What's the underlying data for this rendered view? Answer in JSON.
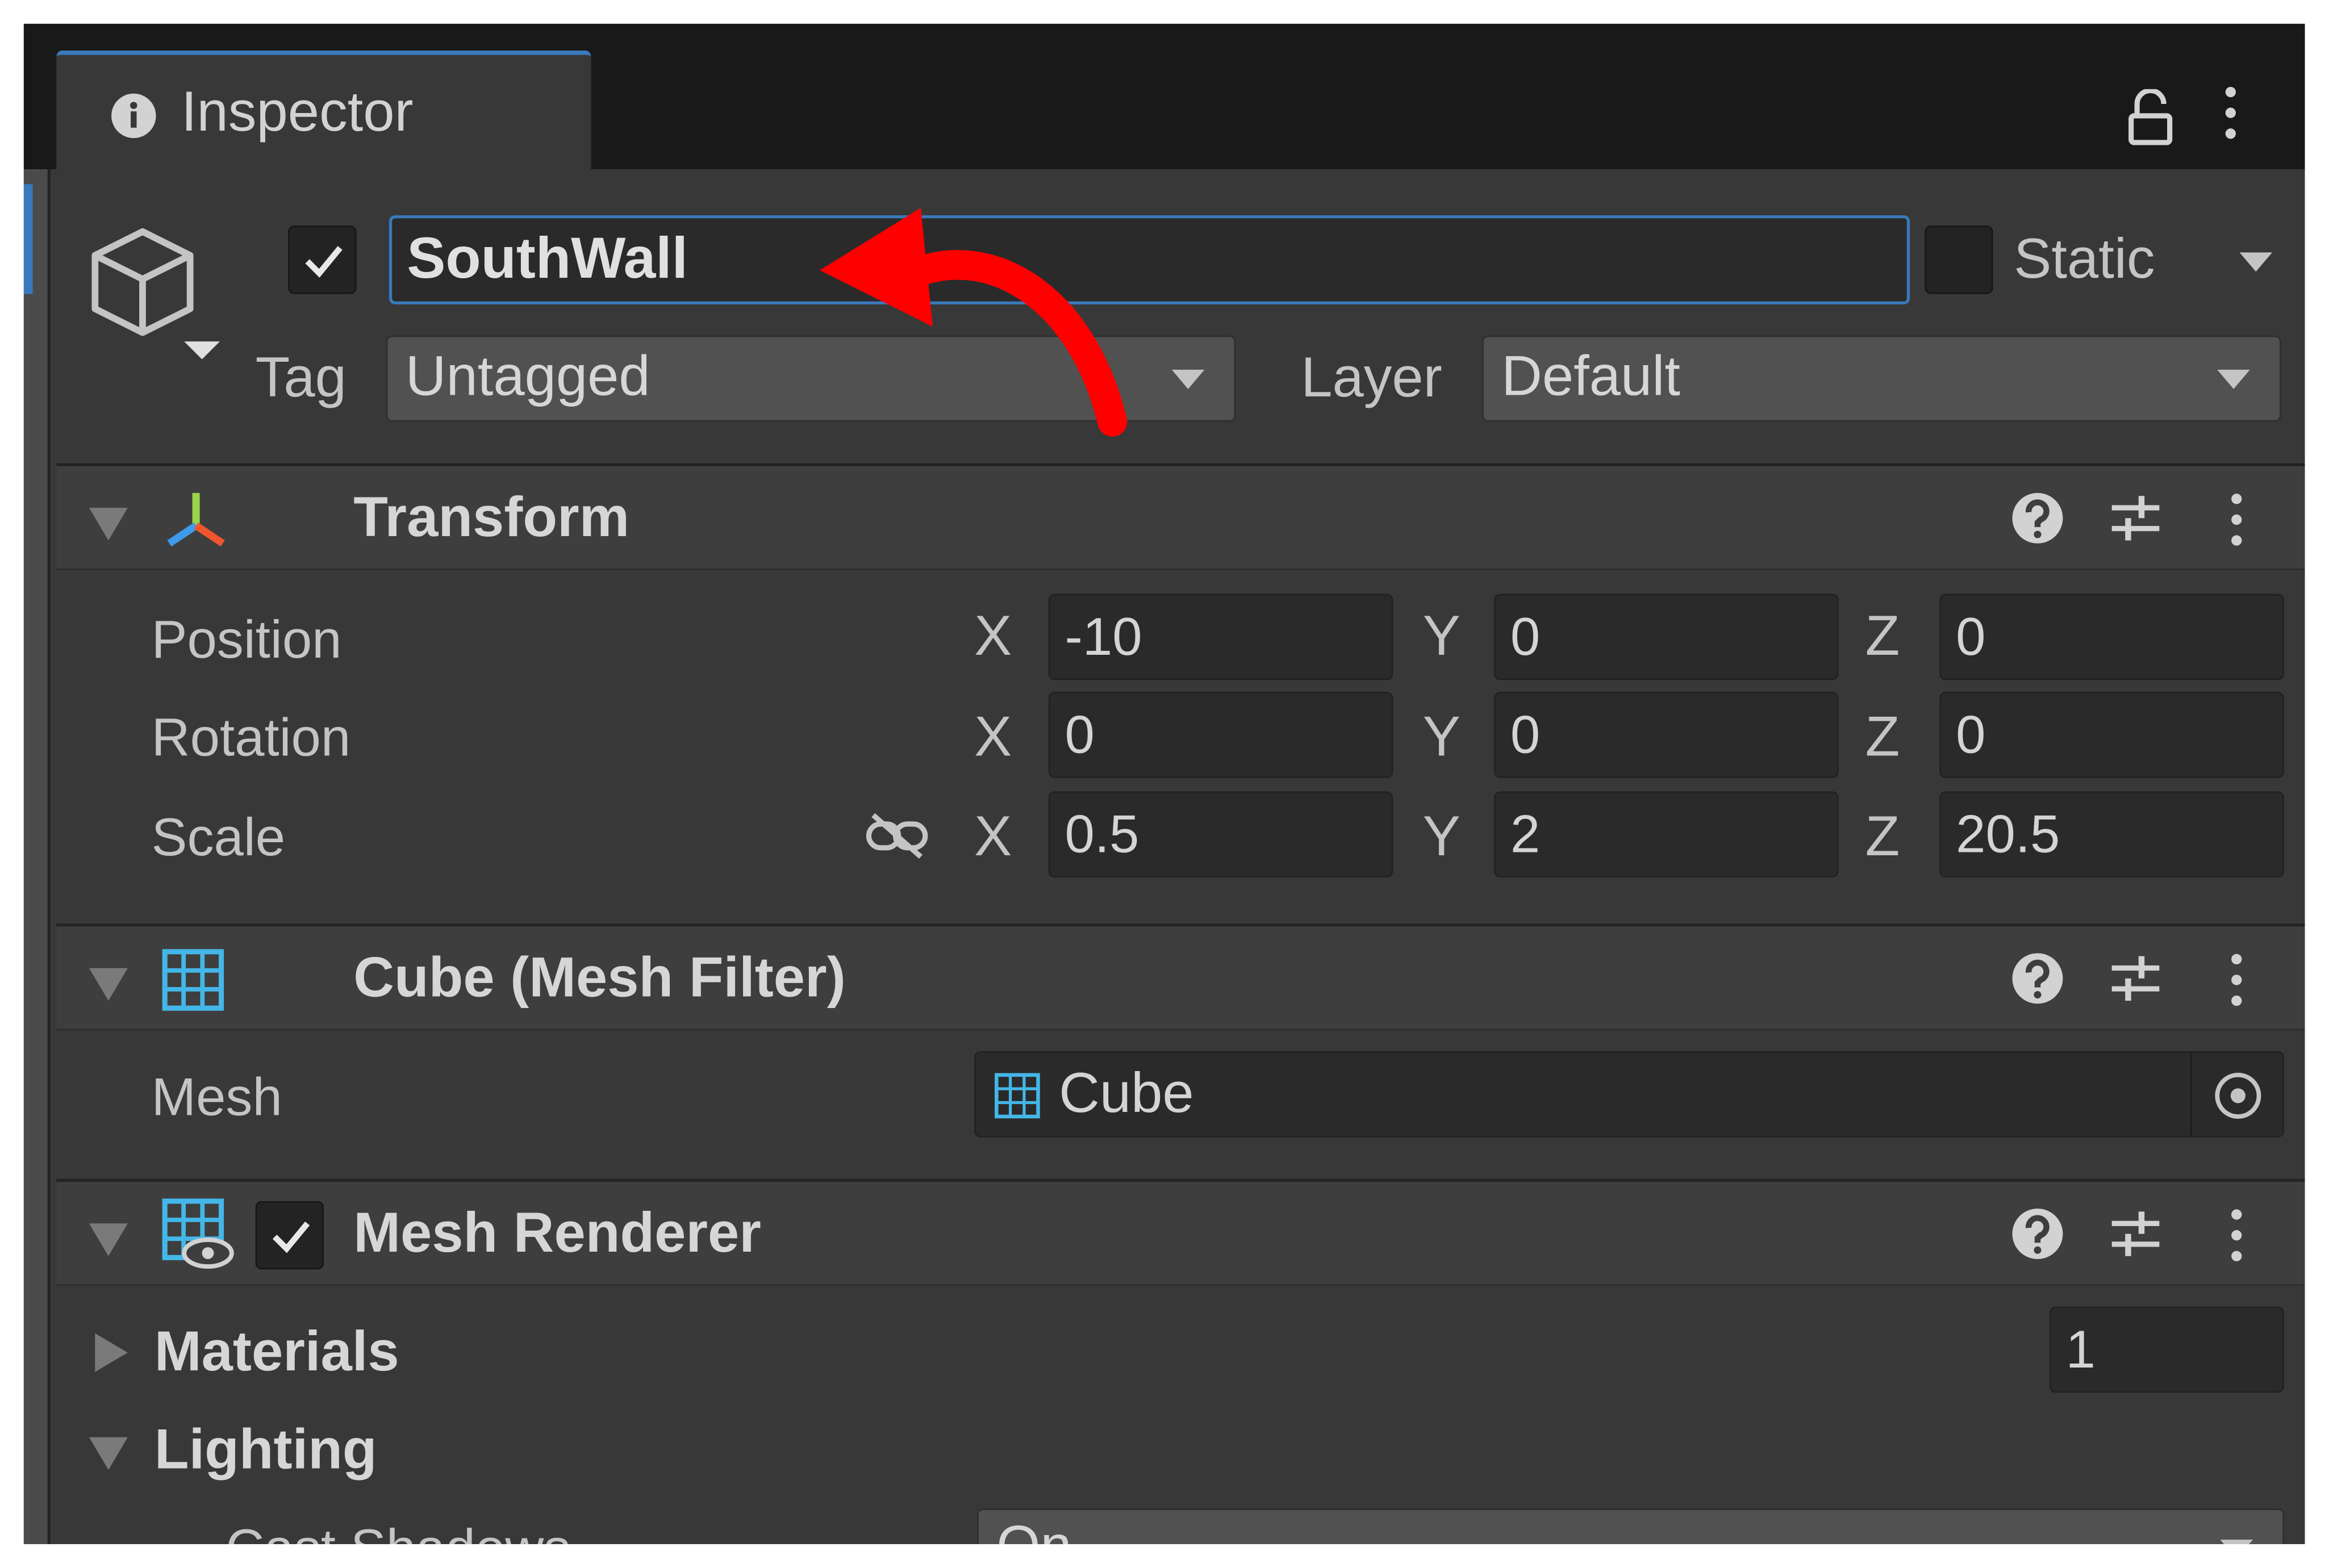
{
  "tab": {
    "title": "Inspector",
    "info_icon": "info-icon",
    "lock_icon": "lock-icon",
    "menu_icon": "kebab-menu-icon"
  },
  "object": {
    "icon": "cube-icon",
    "active": true,
    "name": "SouthWall",
    "static_label": "Static",
    "static_checked": false,
    "tag_label": "Tag",
    "tag_value": "Untagged",
    "layer_label": "Layer",
    "layer_value": "Default"
  },
  "annotation": {
    "type": "red-curved-arrow",
    "color": "#ff0000",
    "points_to": "name-field"
  },
  "transform": {
    "title": "Transform",
    "icon": "transform-gizmo-icon",
    "rows": [
      {
        "label": "Position",
        "x": "-10",
        "y": "0",
        "z": "0"
      },
      {
        "label": "Rotation",
        "x": "0",
        "y": "0",
        "z": "0"
      },
      {
        "label": "Scale",
        "x": "0.5",
        "y": "2",
        "z": "20.5",
        "constrain_icon": "unlinked-chain-icon"
      }
    ],
    "axis_x": "X",
    "axis_y": "Y",
    "axis_z": "Z"
  },
  "mesh_filter": {
    "title": "Cube (Mesh Filter)",
    "icon": "mesh-grid-icon",
    "mesh_label": "Mesh",
    "mesh_value": "Cube"
  },
  "mesh_renderer": {
    "title": "Mesh Renderer",
    "icon": "mesh-renderer-icon",
    "enabled": true,
    "materials_label": "Materials",
    "materials_count": "1",
    "lighting_label": "Lighting",
    "cast_shadows_label": "Cast Shadows",
    "cast_shadows_value": "On"
  },
  "header_icons": {
    "help": "help-icon",
    "presets": "presets-sliders-icon",
    "menu": "kebab-menu-icon"
  },
  "colors": {
    "panel": "#383838",
    "tabbar": "#191919",
    "accent_blue": "#3a79bb",
    "header": "#3e3e3e",
    "field": "#2a2a2a",
    "arrow": "#ff0000"
  }
}
